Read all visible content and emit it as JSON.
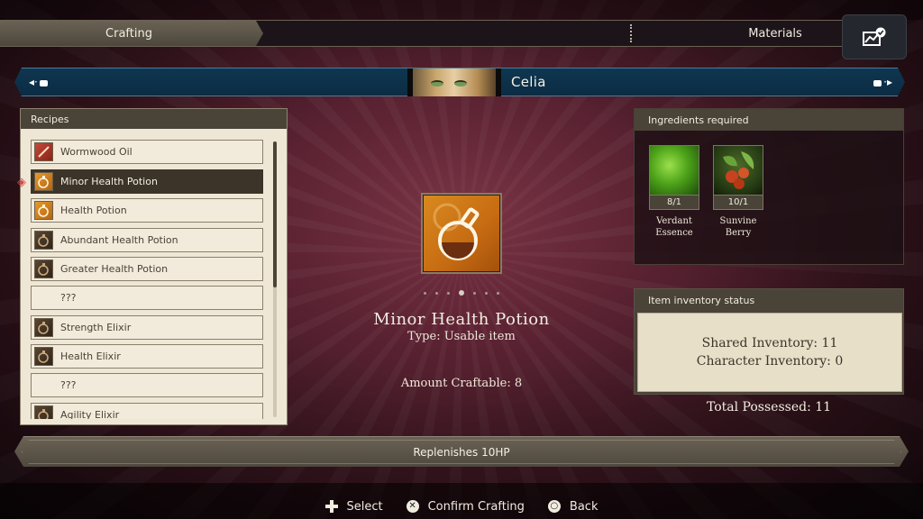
{
  "tabs": {
    "crafting": "Crafting",
    "materials": "Materials"
  },
  "character": {
    "name": "Celia"
  },
  "recipes": {
    "header": "Recipes",
    "items": [
      {
        "label": "Wormwood Oil",
        "icon": "wormwood-oil-icon"
      },
      {
        "label": "Minor Health Potion",
        "icon": "minor-health-potion-icon",
        "selected": true
      },
      {
        "label": "Health Potion",
        "icon": "health-potion-icon"
      },
      {
        "label": "Abundant Health Potion",
        "icon": "abundant-health-potion-icon"
      },
      {
        "label": "Greater Health Potion",
        "icon": "greater-health-potion-icon"
      },
      {
        "label": "???",
        "icon": ""
      },
      {
        "label": "Strength Elixir",
        "icon": "strength-elixir-icon"
      },
      {
        "label": "Health Elixir",
        "icon": "health-elixir-icon"
      },
      {
        "label": "???",
        "icon": ""
      },
      {
        "label": "Agility Elixir",
        "icon": "agility-elixir-icon"
      }
    ]
  },
  "item": {
    "name": "Minor Health Potion",
    "type": "Type: Usable item",
    "amount_craftable": "Amount Craftable: 8",
    "page_dots": 7,
    "page_active": 3
  },
  "ingredients": {
    "header": "Ingredients required",
    "items": [
      {
        "count": "8/1",
        "name_line1": "Verdant",
        "name_line2": "Essence"
      },
      {
        "count": "10/1",
        "name_line1": "Sunvine",
        "name_line2": "Berry"
      }
    ]
  },
  "inventory": {
    "header": "Item inventory status",
    "shared": "Shared Inventory: 11",
    "character": "Character Inventory: 0",
    "total": "Total Possessed: 11"
  },
  "description": "Replenishes 10HP",
  "footer": {
    "select": "Select",
    "confirm": "Confirm Crafting",
    "back": "Back"
  },
  "colors": {
    "accent_selected": "#3c3429",
    "panel": "#efe7d6",
    "charbar": "#0f3650",
    "potion_orange": "#d98a20"
  }
}
